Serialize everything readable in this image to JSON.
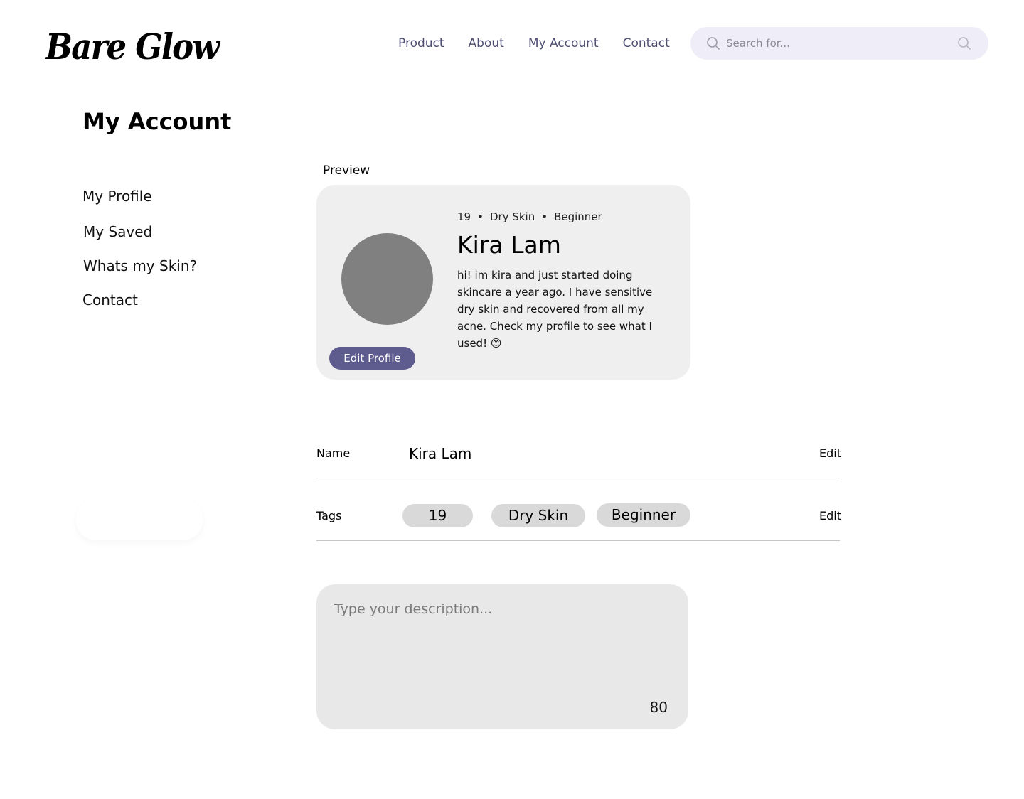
{
  "header": {
    "logo": "Bare Glow",
    "nav": [
      "Product",
      "About",
      "My Account",
      "Contact"
    ],
    "search_placeholder": "Search for..."
  },
  "page": {
    "title": "My Account"
  },
  "sidebar": {
    "items": [
      {
        "label": "My Profile"
      },
      {
        "label": "My Saved"
      },
      {
        "label": "Whats my Skin?"
      },
      {
        "label": "Contact"
      }
    ]
  },
  "preview": {
    "label": "Preview",
    "meta": {
      "age": "19",
      "skin": "Dry Skin",
      "level": "Beginner",
      "separator": "•"
    },
    "name": "Kira Lam",
    "bio": "hi! im kira and just started doing skincare a year ago. I have sensitive dry skin and recovered from all my acne. Check my profile to see what I used! 😊",
    "edit_button": "Edit Profile",
    "avatar_color": "#808080"
  },
  "form": {
    "name_label": "Name",
    "name_value": "Kira Lam",
    "tags_label": "Tags",
    "tags": [
      "19",
      "Dry Skin",
      "Beginner"
    ],
    "edit_label": "Edit",
    "description_placeholder": "Type your description...",
    "char_count": "80"
  },
  "colors": {
    "accent": "#5e5b8e",
    "nav_text": "#4e4e72",
    "search_bg": "#efeef8",
    "card_bg": "#efefef",
    "tag_bg": "#d9d9d9",
    "textarea_bg": "#e8e8e8"
  }
}
